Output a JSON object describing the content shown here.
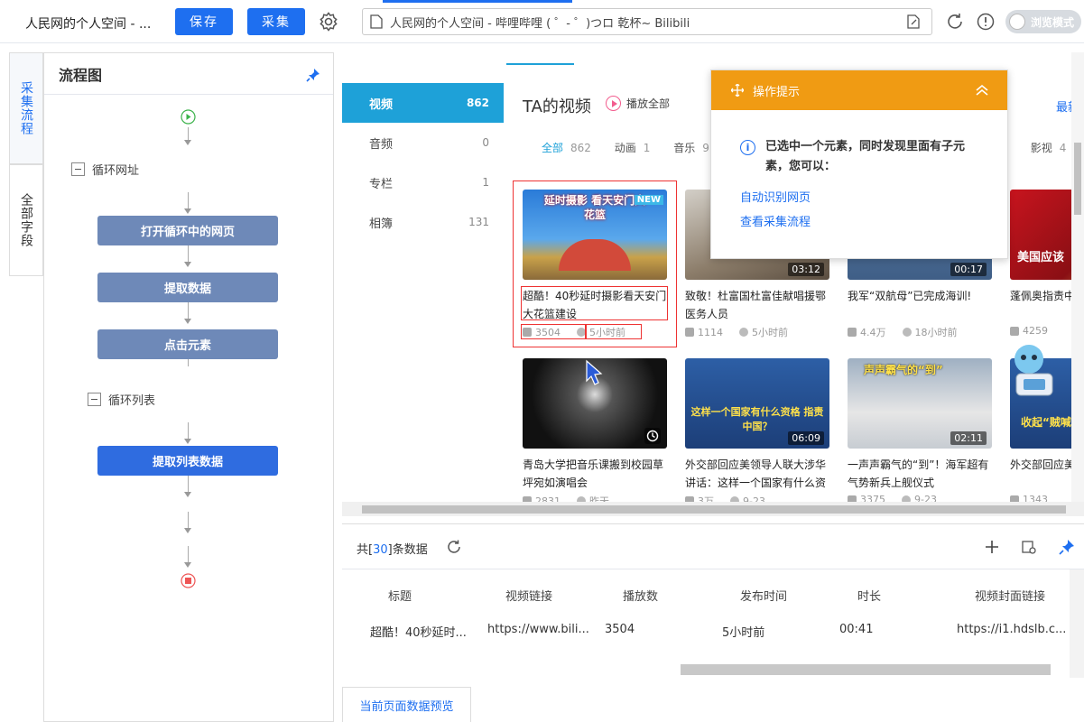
{
  "toolbar": {
    "title": "人民网的个人空间 - ...",
    "save_label": "保存",
    "collect_label": "采集",
    "url_text": "人民网的个人空间 - 哔哩哔哩 ( ゜- ゜)つロ 乾杯~ Bilibili",
    "browse_mode_label": "浏览模式"
  },
  "side_tabs": [
    "采集流程",
    "全部字段"
  ],
  "flow": {
    "title": "流程图",
    "loop_url": "循环网址",
    "open_page": "打开循环中的网页",
    "extract_data": "提取数据",
    "click_element": "点击元素",
    "loop_list": "循环列表",
    "extract_list": "提取列表数据"
  },
  "categories": [
    {
      "label": "视频",
      "count": "862"
    },
    {
      "label": "音频",
      "count": "0"
    },
    {
      "label": "专栏",
      "count": "1"
    },
    {
      "label": "相簿",
      "count": "131"
    }
  ],
  "page": {
    "ta_title": "TA的视频",
    "play_all": "播放全部",
    "latest": "最新",
    "subtabs": [
      {
        "label": "全部",
        "count": "862"
      },
      {
        "label": "动画",
        "count": "1"
      },
      {
        "label": "音乐",
        "count": "9"
      },
      {
        "label": "影视",
        "count": "4"
      }
    ]
  },
  "videos": [
    {
      "title": "超酷！40秒延时摄影看天安门大花篮建设",
      "plays": "3504",
      "time": "5小时前",
      "duration": "",
      "badge": "NEW",
      "overlay": "延时摄影 看天安门大花篮"
    },
    {
      "title": "致敬！杜富国杜富佳献唱援鄂医务人员",
      "plays": "1114",
      "time": "5小时前",
      "duration": "03:12"
    },
    {
      "title": "我军“双航母”已完成海训!",
      "plays": "4.4万",
      "time": "18小时前",
      "duration": "00:17"
    },
    {
      "title": "蓬佩奥指责中况，外交部回",
      "plays": "4259",
      "time": "",
      "duration": "",
      "overlay": "美国应该"
    },
    {
      "title": "青岛大学把音乐课搬到校园草坪宛如演唱会",
      "plays": "2831",
      "time": "昨天",
      "duration": ""
    },
    {
      "title": "外交部回应美领导人联大涉华讲话：这样一个国家有什么资",
      "plays": "3万",
      "time": "9-23",
      "duration": "06:09",
      "overlay": "这样一个国家有什么资格 指责中国？"
    },
    {
      "title": "一声声霸气的“到”！海军超有气势新兵上舰仪式",
      "plays": "3375",
      "time": "9-23",
      "duration": "02:11",
      "overlay": "声声霸气的“到”"
    },
    {
      "title": "外交部回应美选：收起“贼",
      "plays": "1343",
      "time": "",
      "duration": "",
      "overlay": "收起“贼喊"
    }
  ],
  "tip": {
    "header": "操作提示",
    "message": "已选中一个元素，同时发现里面有子元素，您可以：",
    "link1": "自动识别网页",
    "link2": "查看采集流程"
  },
  "bottom": {
    "count_prefix": "共[",
    "count": "30",
    "count_suffix": "]条数据",
    "headers": [
      "标题",
      "视频链接",
      "播放数",
      "发布时间",
      "时长",
      "视频封面链接"
    ],
    "row": [
      "超酷！40秒延时...",
      "https://www.bili...",
      "3504",
      "5小时前",
      "00:41",
      "https://i1.hdslb.c..."
    ],
    "tab": "当前页面数据预览"
  }
}
